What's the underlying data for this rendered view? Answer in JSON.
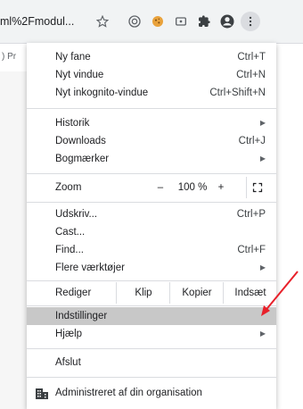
{
  "toolbar": {
    "address_fragment": "ml%2Fmodul...",
    "icons": [
      "star-icon",
      "extension-icon-1",
      "cookie-extension-icon",
      "extension-icon-2",
      "puzzle-icon",
      "profile-icon",
      "more-icon"
    ]
  },
  "bookmarks": {
    "fragment": ") Pr"
  },
  "menu": {
    "new_tab": {
      "label": "Ny fane",
      "shortcut": "Ctrl+T"
    },
    "new_window": {
      "label": "Nyt vindue",
      "shortcut": "Ctrl+N"
    },
    "incognito": {
      "label": "Nyt inkognito-vindue",
      "shortcut": "Ctrl+Shift+N"
    },
    "history": {
      "label": "Historik"
    },
    "downloads": {
      "label": "Downloads",
      "shortcut": "Ctrl+J"
    },
    "bookmarks": {
      "label": "Bogmærker"
    },
    "zoom": {
      "label": "Zoom",
      "minus": "–",
      "value": "100 %",
      "plus": "+"
    },
    "print": {
      "label": "Udskriv...",
      "shortcut": "Ctrl+P"
    },
    "cast": {
      "label": "Cast..."
    },
    "find": {
      "label": "Find...",
      "shortcut": "Ctrl+F"
    },
    "more_tools": {
      "label": "Flere værktøjer"
    },
    "edit": {
      "label": "Rediger",
      "cut": "Klip",
      "copy": "Kopier",
      "paste": "Indsæt"
    },
    "settings": {
      "label": "Indstillinger"
    },
    "help": {
      "label": "Hjælp"
    },
    "exit": {
      "label": "Afslut"
    },
    "managed": {
      "label": "Administreret af din organisation"
    }
  },
  "colors": {
    "highlight": "#c8c8c8",
    "arrow": "#e8202a"
  }
}
